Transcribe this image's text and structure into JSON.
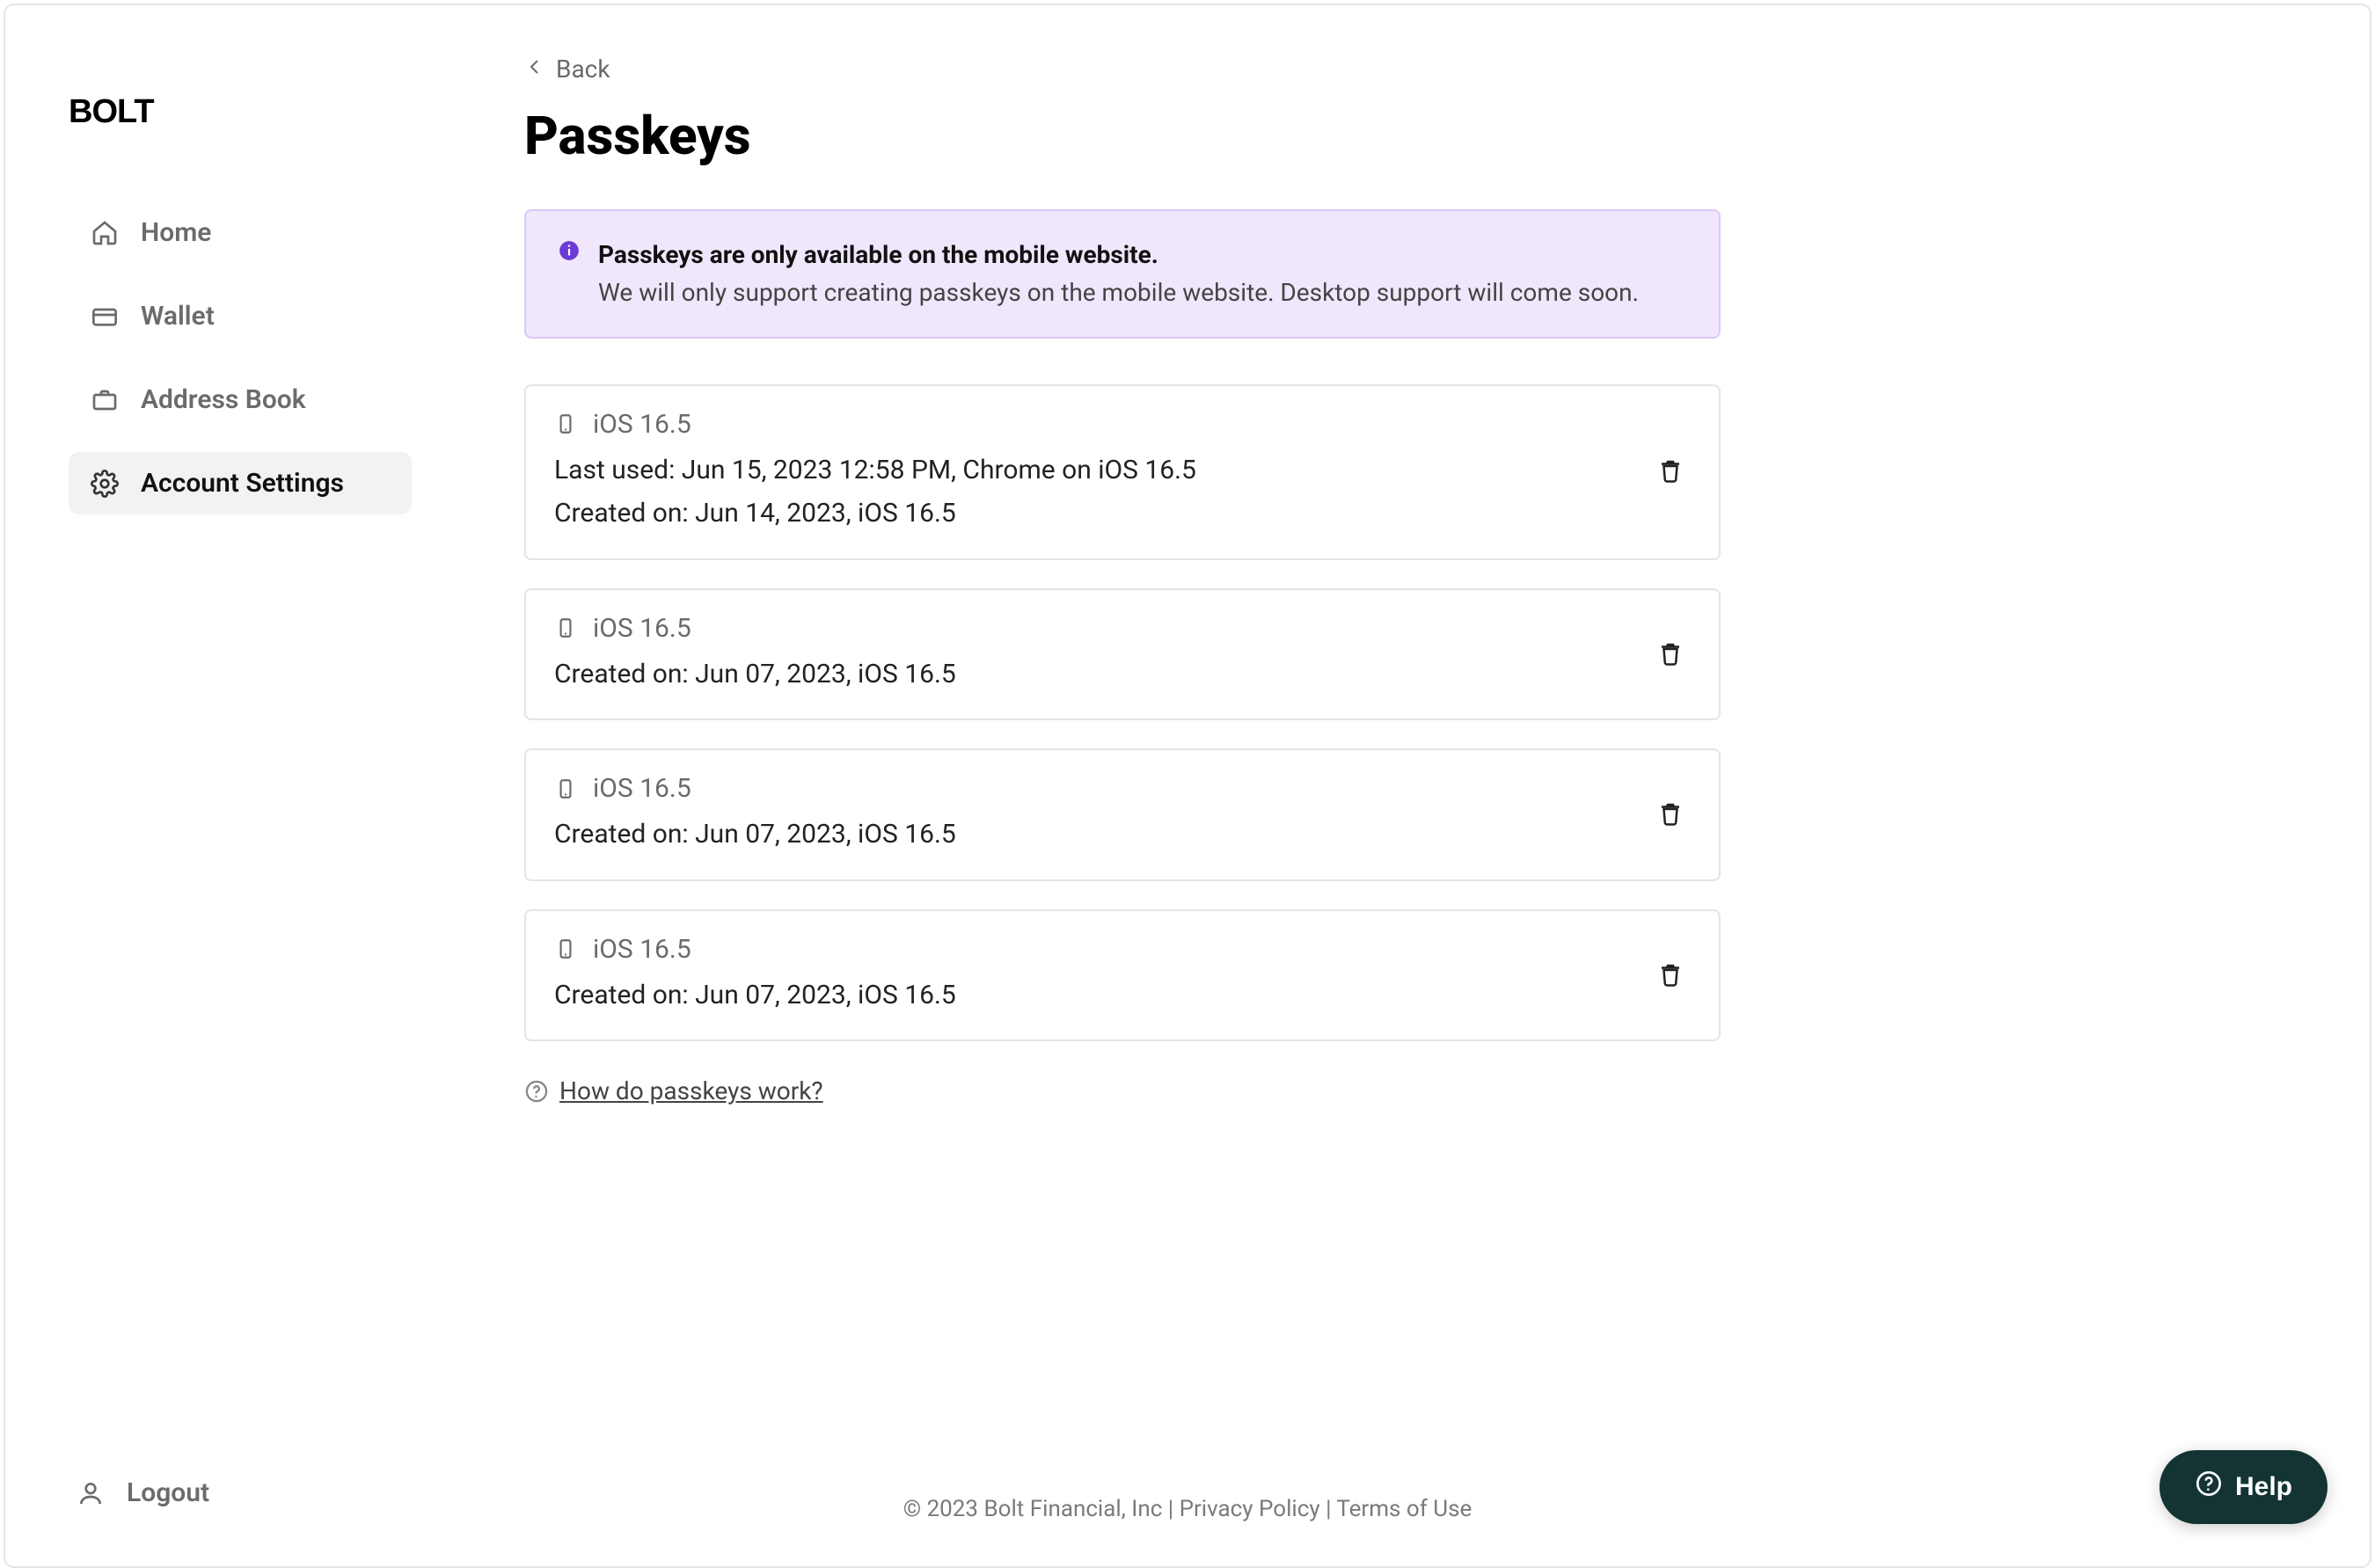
{
  "brand": "BOLT",
  "sidebar": {
    "items": [
      {
        "label": "Home",
        "icon": "home-icon"
      },
      {
        "label": "Wallet",
        "icon": "wallet-icon"
      },
      {
        "label": "Address Book",
        "icon": "briefcase-icon"
      },
      {
        "label": "Account Settings",
        "icon": "gear-icon"
      }
    ],
    "active_index": 3,
    "logout_label": "Logout"
  },
  "back_label": "Back",
  "page_title": "Passkeys",
  "banner": {
    "title": "Passkeys are only available on the mobile website.",
    "body": "We will only support creating passkeys on the mobile website. Desktop support will come soon."
  },
  "passkeys": [
    {
      "device": "iOS 16.5",
      "last_used": "Last used: Jun 15, 2023 12:58 PM, Chrome on iOS 16.5",
      "created": "Created on: Jun 14, 2023, iOS 16.5"
    },
    {
      "device": "iOS 16.5",
      "created": "Created on: Jun 07, 2023, iOS 16.5"
    },
    {
      "device": "iOS 16.5",
      "created": "Created on: Jun 07, 2023, iOS 16.5"
    },
    {
      "device": "iOS 16.5",
      "created": "Created on: Jun 07, 2023, iOS 16.5"
    }
  ],
  "help_link_label": "How do passkeys work?",
  "footer": {
    "copyright": "© 2023 Bolt Financial, Inc",
    "privacy": "Privacy Policy",
    "terms": "Terms of Use",
    "sep": " | "
  },
  "help_fab_label": "Help"
}
